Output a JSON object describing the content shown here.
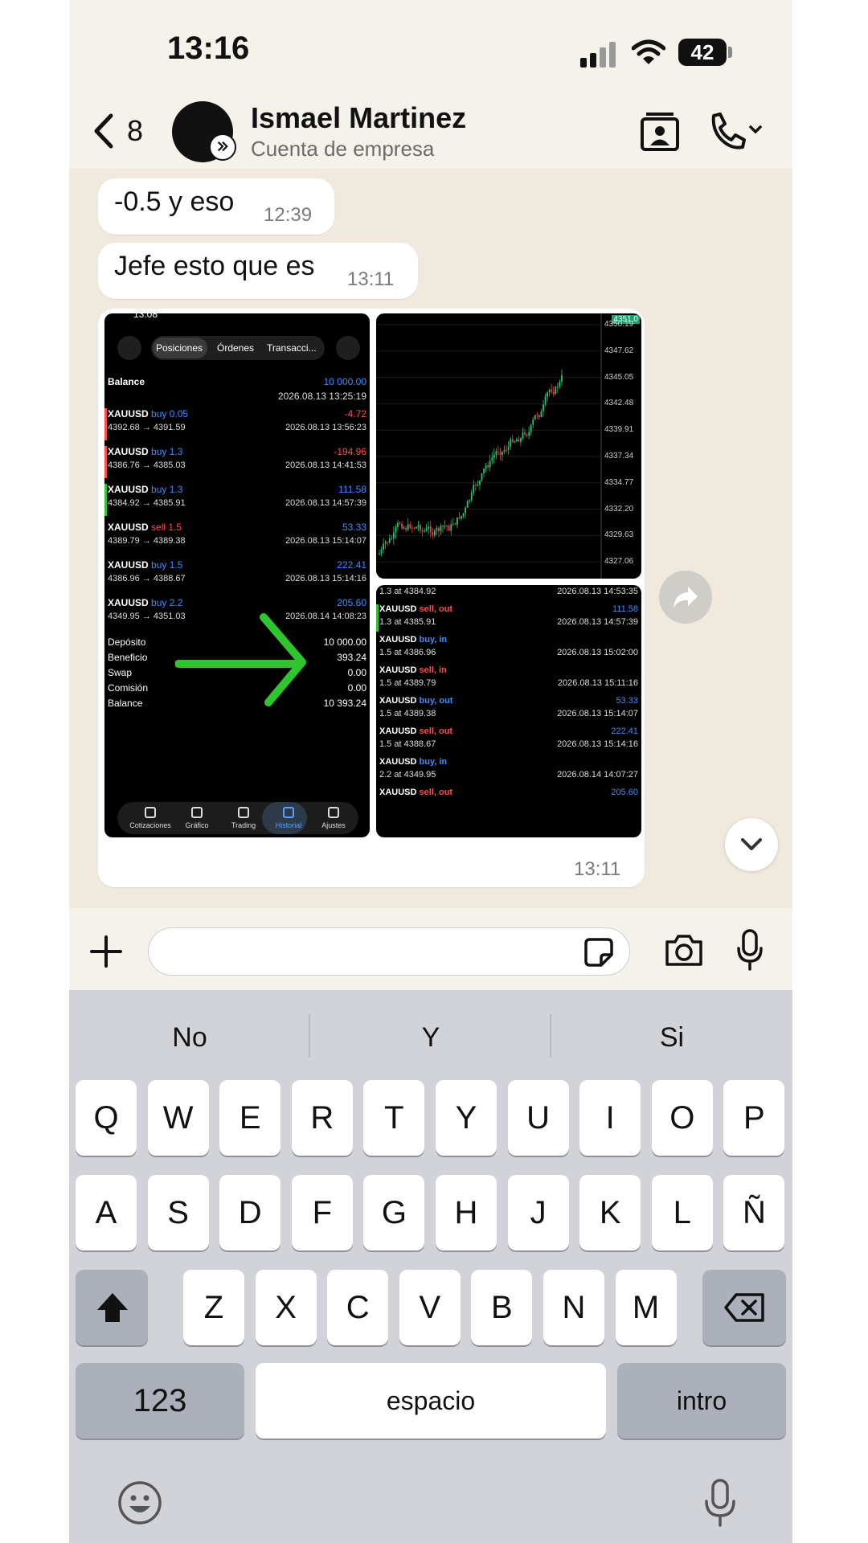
{
  "status_bar": {
    "time": "13:16",
    "battery": "42"
  },
  "header": {
    "back_count": "8",
    "name": "Ismael Martinez",
    "subtitle": "Cuenta de empresa"
  },
  "messages": [
    {
      "text": "-0.5 y eso",
      "time": "12:39"
    },
    {
      "text": "Jefe esto que es",
      "time": "13:11"
    }
  ],
  "image_message": {
    "time": "13:11",
    "left_shot": {
      "clock": "13:08",
      "tabs": [
        "Posiciones",
        "Órdenes",
        "Transacci..."
      ],
      "balance_label": "Balance",
      "balance_value": "10 000.00",
      "balance_date": "2026.08.13 13:25:19",
      "trades": [
        {
          "symbol": "XAUUSD",
          "side": "buy 0.05",
          "profit": "-4.72",
          "prices": "4392.68 → 4391.59",
          "date": "2026.08.13 13:56:23"
        },
        {
          "symbol": "XAUUSD",
          "side": "buy 1.3",
          "profit": "-194.96",
          "prices": "4386.76 → 4385.03",
          "date": "2026.08.13 14:41:53"
        },
        {
          "symbol": "XAUUSD",
          "side": "buy 1.3",
          "profit": "111.58",
          "prices": "4384.92 → 4385.91",
          "date": "2026.08.13 14:57:39"
        },
        {
          "symbol": "XAUUSD",
          "side": "sell 1.5",
          "profit": "53.33",
          "prices": "4389.79 → 4389.38",
          "date": "2026.08.13 15:14:07"
        },
        {
          "symbol": "XAUUSD",
          "side": "buy 1.5",
          "profit": "222.41",
          "prices": "4386.96 → 4388.67",
          "date": "2026.08.13 15:14:16"
        },
        {
          "symbol": "XAUUSD",
          "side": "buy 2.2",
          "profit": "205.60",
          "prices": "4349.95 → 4351.03",
          "date": "2026.08.14 14:08:23"
        }
      ],
      "summary": [
        {
          "label": "Depósito",
          "value": "10 000.00"
        },
        {
          "label": "Beneficio",
          "value": "393.24"
        },
        {
          "label": "Swap",
          "value": "0.00"
        },
        {
          "label": "Comisión",
          "value": "0.00"
        },
        {
          "label": "Balance",
          "value": "10 393.24"
        }
      ],
      "nav": [
        "Cotizaciones",
        "Gráfico",
        "Trading",
        "Historial",
        "Ajustes"
      ]
    },
    "chart_shot": {
      "price_labels": [
        "4350.19",
        "4347.62",
        "4345.05",
        "4342.48",
        "4339.91",
        "4337.34",
        "4334.77",
        "4332.20",
        "4329.63",
        "4327.06"
      ],
      "current_price": "4351.0"
    },
    "deals_shot": {
      "top_row": {
        "text": "1.3 at 4384.92",
        "date": "2026.08.13 14:53:35"
      },
      "deals": [
        {
          "symbol": "XAUUSD",
          "side": "sell, out",
          "profit": "111.58",
          "detail": "1.3 at 4385.91",
          "date": "2026.08.13 14:57:39"
        },
        {
          "symbol": "XAUUSD",
          "side": "buy, in",
          "profit": "",
          "detail": "1.5 at 4386.96",
          "date": "2026.08.13 15:02:00"
        },
        {
          "symbol": "XAUUSD",
          "side": "sell, in",
          "profit": "",
          "detail": "1.5 at 4389.79",
          "date": "2026.08.13 15:11:16"
        },
        {
          "symbol": "XAUUSD",
          "side": "buy, out",
          "profit": "53.33",
          "detail": "1.5 at 4389.38",
          "date": "2026.08.13 15:14:07"
        },
        {
          "symbol": "XAUUSD",
          "side": "sell, out",
          "profit": "222.41",
          "detail": "1.5 at 4388.67",
          "date": "2026.08.13 15:14:16"
        },
        {
          "symbol": "XAUUSD",
          "side": "buy, in",
          "profit": "",
          "detail": "2.2 at 4349.95",
          "date": "2026.08.14 14:07:27"
        },
        {
          "symbol": "XAUUSD",
          "side": "sell, out",
          "profit": "205.60",
          "detail": "",
          "date": ""
        }
      ]
    }
  },
  "keyboard": {
    "suggestions": [
      "No",
      "Y",
      "Si"
    ],
    "row1": [
      "Q",
      "W",
      "E",
      "R",
      "T",
      "Y",
      "U",
      "I",
      "O",
      "P"
    ],
    "row2": [
      "A",
      "S",
      "D",
      "F",
      "G",
      "H",
      "J",
      "K",
      "L",
      "Ñ"
    ],
    "row3": [
      "Z",
      "X",
      "C",
      "V",
      "B",
      "N",
      "M"
    ],
    "numbers_key": "123",
    "space_key": "espacio",
    "return_key": "intro"
  }
}
